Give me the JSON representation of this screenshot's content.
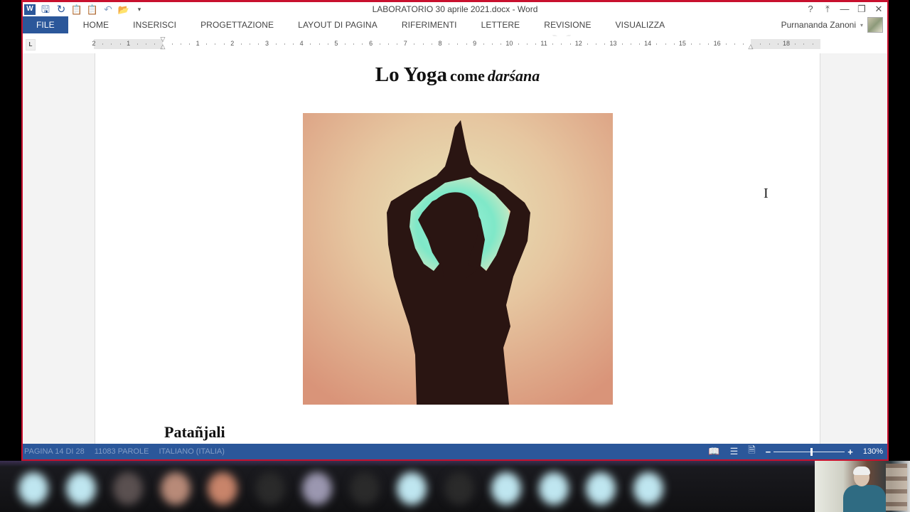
{
  "app": {
    "window_title": "LABORATORIO 30 aprile 2021.docx - Word",
    "user_name": "Purnananda Zanoni"
  },
  "quick_access": [
    {
      "icon": "word-logo-icon",
      "glyph": "W"
    },
    {
      "icon": "save-icon",
      "glyph": "🖫"
    },
    {
      "icon": "refresh-icon",
      "glyph": "↻"
    },
    {
      "icon": "paste-icon",
      "glyph": "📋"
    },
    {
      "icon": "paste-options-icon",
      "glyph": "📋"
    },
    {
      "icon": "undo-icon",
      "glyph": "↶"
    },
    {
      "icon": "open-folder-icon",
      "glyph": "📂"
    },
    {
      "icon": "customize-qat-icon",
      "glyph": "▾"
    }
  ],
  "window_controls": {
    "help": "?",
    "ribbon_display": "⤒",
    "minimize": "—",
    "restore": "❐",
    "close": "✕"
  },
  "ribbon": {
    "tabs": [
      "FILE",
      "HOME",
      "INSERISCI",
      "PROGETTAZIONE",
      "LAYOUT DI PAGINA",
      "RIFERIMENTI",
      "LETTERE",
      "REVISIONE",
      "VISUALIZZA"
    ],
    "active_tab": "FILE"
  },
  "ruler": {
    "tab_selector": "L",
    "labels": [
      "2",
      "1",
      "",
      "1",
      "2",
      "3",
      "4",
      "5",
      "6",
      "7",
      "8",
      "9",
      "10",
      "11",
      "12",
      "13",
      "14",
      "15",
      "16",
      "",
      "18"
    ]
  },
  "document": {
    "heading_part1": "Lo Yoga",
    "heading_part2": "come",
    "heading_part3": "darśana",
    "image_description": "Silhouette of a woman in yoga pose with hands joined above head against a peach background",
    "subheading": "Patañjali",
    "cursor_glyph": "I"
  },
  "statusbar": {
    "page": "PAGINA 14 DI 28",
    "words": "11083 PAROLE",
    "language": "ITALIANO (ITALIA)",
    "view_icons": {
      "read_mode": "📖",
      "print_layout": "☰",
      "web_layout": "🗎"
    },
    "zoom_minus": "−",
    "zoom_plus": "+",
    "zoom_level": "130%",
    "zoom_fraction": 0.53
  },
  "call": {
    "participant_colors": [
      "#bfe6f0",
      "#bfe6f0",
      "#5a5050",
      "#b88a78",
      "#c8846a",
      "#2a2a2a",
      "#9b97b0",
      "#2a2a2a",
      "#bfe6f0",
      "#2a2a2a",
      "#bfe6f0",
      "#bfe6f0",
      "#bfe6f0",
      "#bfe6f0"
    ]
  },
  "colors": {
    "accent": "#2b579a",
    "window_border": "#c8102e"
  }
}
